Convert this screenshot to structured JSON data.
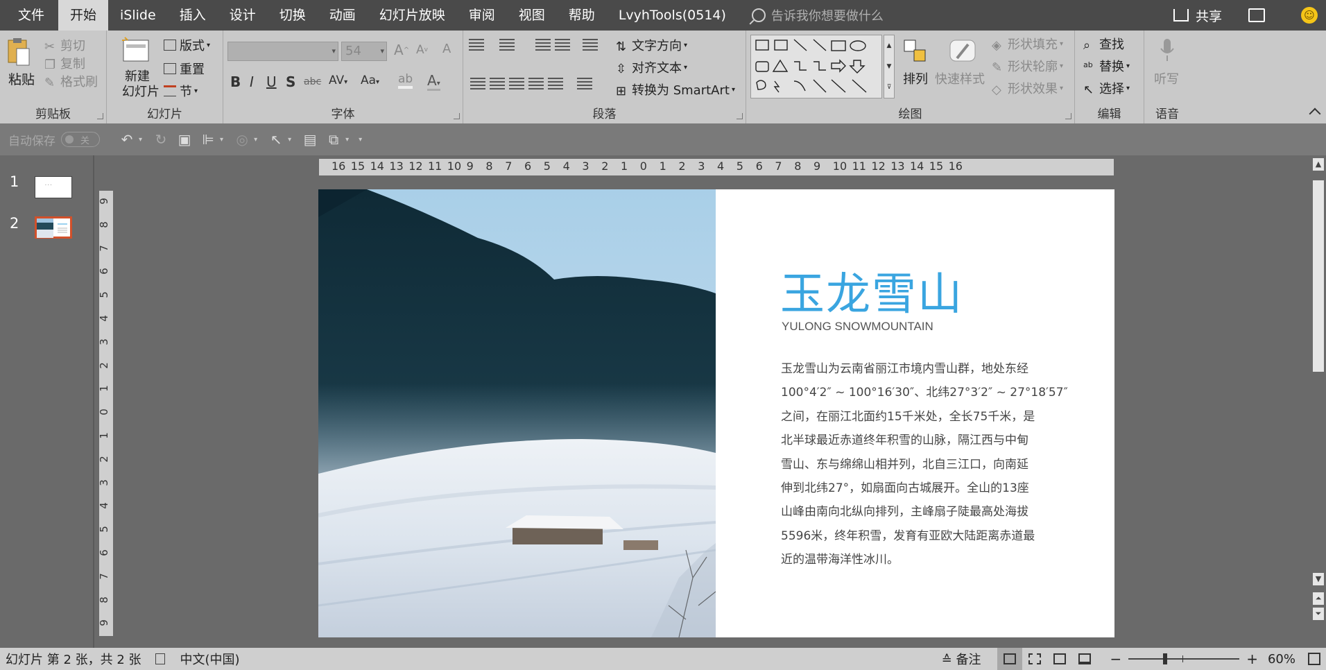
{
  "tabs": [
    "文件",
    "开始",
    "iSlide",
    "插入",
    "设计",
    "切换",
    "动画",
    "幻灯片放映",
    "审阅",
    "视图",
    "帮助",
    "LvyhTools(0514)"
  ],
  "active_tab": "开始",
  "tellme_placeholder": "告诉我你想要做什么",
  "share_label": "共享",
  "ribbon": {
    "clipboard": {
      "label": "剪贴板",
      "paste": "粘贴",
      "cut": "剪切",
      "copy": "复制",
      "format_painter": "格式刷"
    },
    "slides": {
      "label": "幻灯片",
      "new_slide_line1": "新建",
      "new_slide_line2": "幻灯片",
      "layout": "版式",
      "reset": "重置",
      "section": "节"
    },
    "font": {
      "label": "字体",
      "font_size": "54"
    },
    "paragraph": {
      "label": "段落",
      "text_direction": "文字方向",
      "align_text": "对齐文本",
      "smartart": "转换为 SmartArt"
    },
    "drawing": {
      "label": "绘图",
      "arrange": "排列",
      "quick_styles": "快速样式",
      "shape_fill": "形状填充",
      "shape_outline": "形状轮廓",
      "shape_effects": "形状效果"
    },
    "editing": {
      "label": "编辑",
      "find": "查找",
      "replace": "替换",
      "select": "选择"
    },
    "voice": {
      "label": "语音",
      "dictate": "听写"
    }
  },
  "qat": {
    "autosave_label": "自动保存",
    "autosave_state": "关"
  },
  "thumbnails": [
    {
      "number": "1",
      "selected": false
    },
    {
      "number": "2",
      "selected": true
    }
  ],
  "ruler_h": [
    "16",
    "15",
    "14",
    "13",
    "12",
    "11",
    "10",
    "9",
    "8",
    "7",
    "6",
    "5",
    "4",
    "3",
    "2",
    "1",
    "0",
    "1",
    "2",
    "3",
    "4",
    "5",
    "6",
    "7",
    "8",
    "9",
    "10",
    "11",
    "12",
    "13",
    "14",
    "15",
    "16"
  ],
  "ruler_v": [
    "9",
    "8",
    "7",
    "6",
    "5",
    "4",
    "3",
    "2",
    "1",
    "0",
    "1",
    "2",
    "3",
    "4",
    "5",
    "6",
    "7",
    "8",
    "9"
  ],
  "slide": {
    "title": "玉龙雪山",
    "subtitle": "YULONG SNOWMOUNTAIN",
    "body_lines": [
      "玉龙雪山为云南省丽江市境内雪山群，地处东经",
      "100°4′2″ ~ 100°16′30″、北纬27°3′2″ ~ 27°18′57″",
      "之间，在丽江北面约15千米处，全长75千米，是",
      "北半球最近赤道终年积雪的山脉，隔江西与中甸",
      "雪山、东与绵绵山相并列，北自三江口，向南延",
      "伸到北纬27°，如扇面向古城展开。全山的13座",
      "山峰由南向北纵向排列，主峰扇子陡最高处海拔",
      "5596米，终年积雪，发育有亚欧大陆距离赤道最",
      "近的温带海洋性冰川。"
    ],
    "title_color": "#3aa5e0"
  },
  "status": {
    "slide_info": "幻灯片 第 2 张，共 2 张",
    "language": "中文(中国)",
    "notes": "备注",
    "zoom": "60%"
  },
  "colors": {
    "accent": "#d2502a",
    "ribbon": "#c9c9c9",
    "titlebar": "#4a4a4a"
  }
}
